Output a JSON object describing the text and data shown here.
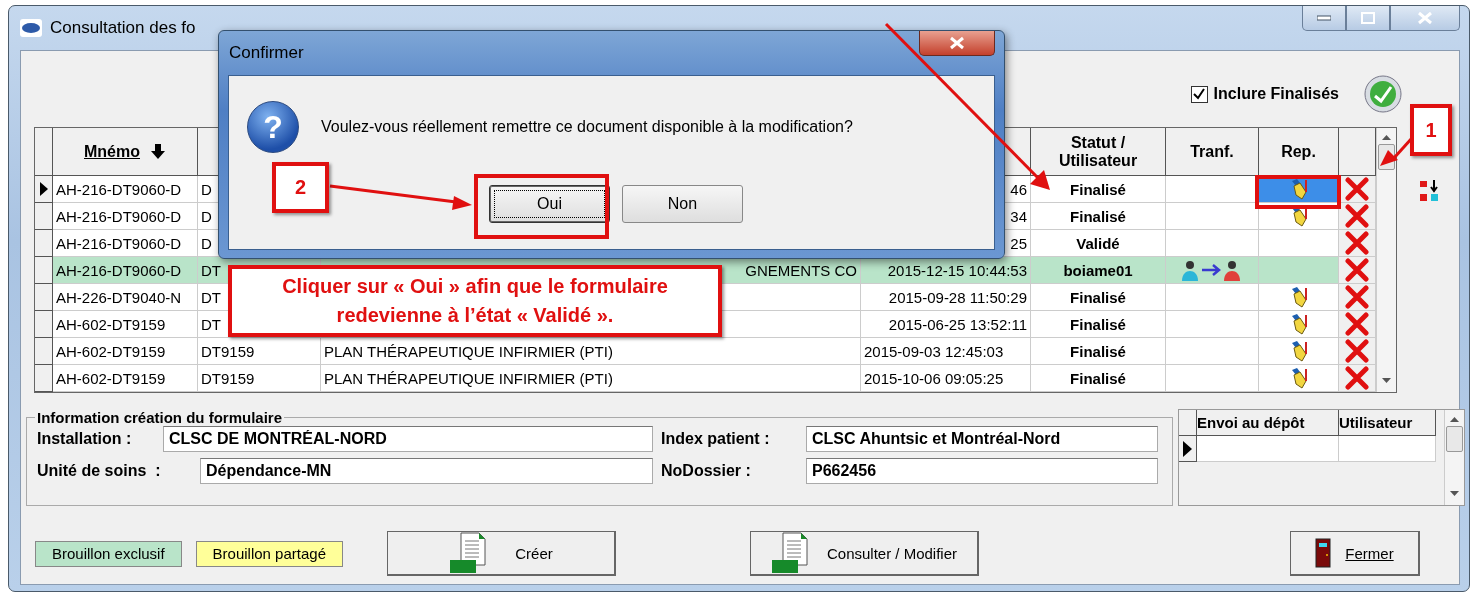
{
  "window": {
    "title": "Consultation des fo"
  },
  "filter": {
    "label": "Inclure Finalisés",
    "checked": true
  },
  "table": {
    "header": {
      "mnemo": "Mnémo",
      "status": "Statut / Utilisateur",
      "tranf": "Tranf.",
      "rep": "Rep."
    },
    "rows": [
      {
        "current": true,
        "covered": true,
        "exclusive_draft": false,
        "mnemo": "AH-216-DT9060-D",
        "code": "D",
        "date": "46",
        "status": "Finalisé",
        "transfer": false,
        "reopen": true,
        "rep_selected": true
      },
      {
        "current": false,
        "covered": true,
        "exclusive_draft": false,
        "mnemo": "AH-216-DT9060-D",
        "code": "D",
        "date": "34",
        "status": "Finalisé",
        "transfer": false,
        "reopen": true,
        "rep_selected": false
      },
      {
        "current": false,
        "covered": true,
        "exclusive_draft": false,
        "mnemo": "AH-216-DT9060-D",
        "code": "D",
        "date": "25",
        "status": "Validé",
        "transfer": false,
        "reopen": false,
        "rep_selected": false
      },
      {
        "current": false,
        "covered": true,
        "exclusive_draft": true,
        "mnemo": "AH-216-DT9060-D",
        "code": "DT",
        "title": "GNEMENTS CO",
        "date": "2015-12-15 10:44:53",
        "status": "boiame01",
        "transfer": true,
        "reopen": false,
        "rep_selected": false
      },
      {
        "current": false,
        "covered": true,
        "exclusive_draft": false,
        "mnemo": "AH-226-DT9040-N",
        "code": "DT",
        "date": "2015-09-28 11:50:29",
        "status": "Finalisé",
        "transfer": false,
        "reopen": true,
        "rep_selected": false
      },
      {
        "current": false,
        "covered": true,
        "exclusive_draft": false,
        "mnemo": "AH-602-DT9159",
        "code": "DT",
        "date": "2015-06-25 13:52:11",
        "status": "Finalisé",
        "transfer": false,
        "reopen": true,
        "rep_selected": false
      },
      {
        "current": false,
        "covered": false,
        "exclusive_draft": false,
        "mnemo": "AH-602-DT9159",
        "code": "DT9159",
        "title": "PLAN THÉRAPEUTIQUE INFIRMIER (PTI)",
        "date": "2015-09-03 12:45:03",
        "status": "Finalisé",
        "transfer": false,
        "reopen": true,
        "rep_selected": false
      },
      {
        "current": false,
        "covered": false,
        "exclusive_draft": false,
        "mnemo": "AH-602-DT9159",
        "code": "DT9159",
        "title": "PLAN THÉRAPEUTIQUE INFIRMIER (PTI)",
        "date": "2015-10-06 09:05:25",
        "status": "Finalisé",
        "transfer": false,
        "reopen": true,
        "rep_selected": false
      }
    ]
  },
  "form_info": {
    "title": "Information création du formulaire",
    "rows": [
      {
        "label": "Installation :",
        "value": "CLSC DE MONTRÉAL-NORD",
        "label2": "Index patient :",
        "value2": "CLSC Ahuntsic et Montréal-Nord"
      },
      {
        "label": "Unité de soins  :",
        "value": "Dépendance-MN",
        "label2": "NoDossier :",
        "value2": "P662456"
      }
    ]
  },
  "depot": {
    "columns": [
      "Envoi au dépôt",
      "Utilisateur"
    ],
    "rows": [
      {
        "current": true
      }
    ]
  },
  "legend": [
    {
      "label": "Brouillon exclusif",
      "color": "#b9e4c9"
    },
    {
      "label": "Brouillon partagé",
      "color": "#ffff99"
    }
  ],
  "buttons": [
    {
      "label": "Créer",
      "kind": "pdf",
      "underlined": false
    },
    {
      "label": "Consulter / Modifier",
      "kind": "pdf",
      "underlined": false
    },
    {
      "label": "Fermer",
      "kind": "exit",
      "underlined": true
    }
  ],
  "dialog": {
    "title": "Confirmer",
    "icon": "?",
    "message": "Voulez-vous réellement remettre ce document disponible à la modification?",
    "buttons": [
      {
        "label": "Oui",
        "focused": true
      },
      {
        "label": "Non",
        "focused": false
      }
    ]
  },
  "annotations": {
    "steps": [
      "1",
      "2"
    ],
    "callout": "Cliquer sur « Oui » afin que le formulaire redevienne à l’état « Validé »."
  }
}
